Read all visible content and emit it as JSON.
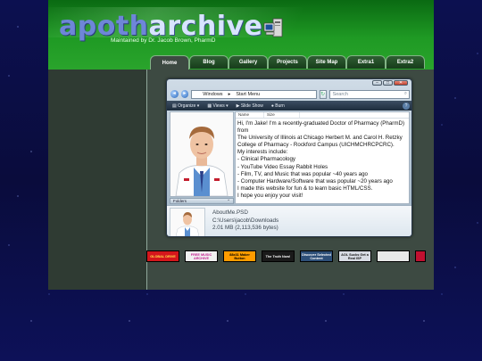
{
  "site": {
    "logo_part1": "apoth",
    "logo_part2": "archive",
    "tagline": "Maintained by Dr. Jacob Brown, PharmD"
  },
  "nav": {
    "tabs": [
      "Home",
      "Blog",
      "Gallery",
      "Projects",
      "Site Map",
      "Extra1",
      "Extra2"
    ],
    "active": "Home"
  },
  "explorer": {
    "address": [
      "Windows",
      "Start Menu"
    ],
    "search_placeholder": "Search",
    "toolbar": [
      "Organize",
      "Views",
      "Slide Show",
      "Burn"
    ],
    "columns": [
      "Name",
      "Size"
    ],
    "folders_label": "Folders",
    "about_lines": [
      "Hi, I'm Jake! I'm a recently-graduated Doctor of Pharmacy (PharmD) from",
      "The University of Illinois at Chicago Herbert M. and Carol H. Retzky",
      "College of Pharmacy - Rockford Campus (UICHMCHRCPCRC).",
      "My interests include:",
      "- Clinical Pharmacology",
      "- YouTube Video Essay Rabbit Holes",
      "- Film, TV, and Music that was popular ~40 years ago",
      "- Computer Hardware/Software that was popular ~20 years ago",
      "I made this website for fun & to learn basic HTML/CSS.",
      "I hope you enjoy your visit!"
    ],
    "details": {
      "filename": "AboutMe.PSD",
      "path": "C:\\Users\\jacob\\Downloads",
      "size": "2.01 MB (2,113,536 bytes)"
    }
  },
  "buttons": [
    {
      "label": "GLOBAL DRIVE",
      "bg": "#d4161c",
      "fg": "#ffe34a"
    },
    {
      "label": "FREE MUSIC ARCHIVE",
      "bg": "#f0f0f0",
      "fg": "#c21c8e"
    },
    {
      "label": "88x31 Maker Button",
      "bg": "#ff9c00",
      "fg": "#000000"
    },
    {
      "label": "The Truth Now!",
      "bg": "#1a1a1a",
      "fg": "#ffffff"
    },
    {
      "label": "Discover Selected Content",
      "bg": "#2d4f78",
      "fg": "#ffffff"
    },
    {
      "label": "AOL Sucks Get a Real ISP",
      "bg": "#d8dce4",
      "fg": "#111111"
    },
    {
      "label": "",
      "bg": "#e8e8e8",
      "fg": "#333333"
    },
    {
      "label": "",
      "bg": "#c01030",
      "fg": "#ffffff"
    }
  ]
}
